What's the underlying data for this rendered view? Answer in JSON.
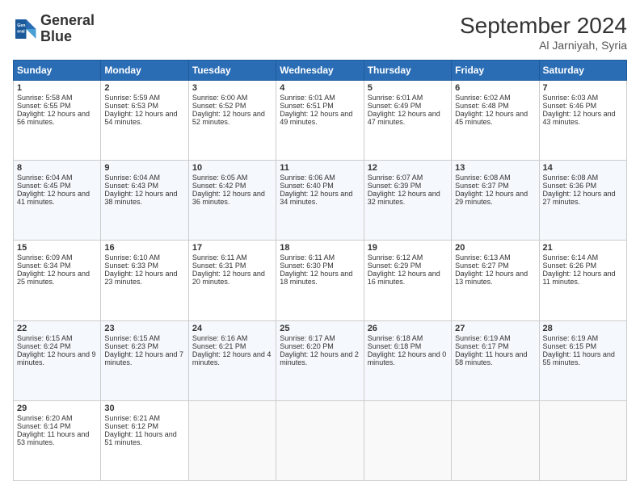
{
  "logo": {
    "line1": "General",
    "line2": "Blue"
  },
  "title": "September 2024",
  "subtitle": "Al Jarniyah, Syria",
  "headers": [
    "Sunday",
    "Monday",
    "Tuesday",
    "Wednesday",
    "Thursday",
    "Friday",
    "Saturday"
  ],
  "weeks": [
    [
      {
        "day": "1",
        "content": "Sunrise: 5:58 AM\nSunset: 6:55 PM\nDaylight: 12 hours and 56 minutes."
      },
      {
        "day": "2",
        "content": "Sunrise: 5:59 AM\nSunset: 6:53 PM\nDaylight: 12 hours and 54 minutes."
      },
      {
        "day": "3",
        "content": "Sunrise: 6:00 AM\nSunset: 6:52 PM\nDaylight: 12 hours and 52 minutes."
      },
      {
        "day": "4",
        "content": "Sunrise: 6:01 AM\nSunset: 6:51 PM\nDaylight: 12 hours and 49 minutes."
      },
      {
        "day": "5",
        "content": "Sunrise: 6:01 AM\nSunset: 6:49 PM\nDaylight: 12 hours and 47 minutes."
      },
      {
        "day": "6",
        "content": "Sunrise: 6:02 AM\nSunset: 6:48 PM\nDaylight: 12 hours and 45 minutes."
      },
      {
        "day": "7",
        "content": "Sunrise: 6:03 AM\nSunset: 6:46 PM\nDaylight: 12 hours and 43 minutes."
      }
    ],
    [
      {
        "day": "8",
        "content": "Sunrise: 6:04 AM\nSunset: 6:45 PM\nDaylight: 12 hours and 41 minutes."
      },
      {
        "day": "9",
        "content": "Sunrise: 6:04 AM\nSunset: 6:43 PM\nDaylight: 12 hours and 38 minutes."
      },
      {
        "day": "10",
        "content": "Sunrise: 6:05 AM\nSunset: 6:42 PM\nDaylight: 12 hours and 36 minutes."
      },
      {
        "day": "11",
        "content": "Sunrise: 6:06 AM\nSunset: 6:40 PM\nDaylight: 12 hours and 34 minutes."
      },
      {
        "day": "12",
        "content": "Sunrise: 6:07 AM\nSunset: 6:39 PM\nDaylight: 12 hours and 32 minutes."
      },
      {
        "day": "13",
        "content": "Sunrise: 6:08 AM\nSunset: 6:37 PM\nDaylight: 12 hours and 29 minutes."
      },
      {
        "day": "14",
        "content": "Sunrise: 6:08 AM\nSunset: 6:36 PM\nDaylight: 12 hours and 27 minutes."
      }
    ],
    [
      {
        "day": "15",
        "content": "Sunrise: 6:09 AM\nSunset: 6:34 PM\nDaylight: 12 hours and 25 minutes."
      },
      {
        "day": "16",
        "content": "Sunrise: 6:10 AM\nSunset: 6:33 PM\nDaylight: 12 hours and 23 minutes."
      },
      {
        "day": "17",
        "content": "Sunrise: 6:11 AM\nSunset: 6:31 PM\nDaylight: 12 hours and 20 minutes."
      },
      {
        "day": "18",
        "content": "Sunrise: 6:11 AM\nSunset: 6:30 PM\nDaylight: 12 hours and 18 minutes."
      },
      {
        "day": "19",
        "content": "Sunrise: 6:12 AM\nSunset: 6:29 PM\nDaylight: 12 hours and 16 minutes."
      },
      {
        "day": "20",
        "content": "Sunrise: 6:13 AM\nSunset: 6:27 PM\nDaylight: 12 hours and 13 minutes."
      },
      {
        "day": "21",
        "content": "Sunrise: 6:14 AM\nSunset: 6:26 PM\nDaylight: 12 hours and 11 minutes."
      }
    ],
    [
      {
        "day": "22",
        "content": "Sunrise: 6:15 AM\nSunset: 6:24 PM\nDaylight: 12 hours and 9 minutes."
      },
      {
        "day": "23",
        "content": "Sunrise: 6:15 AM\nSunset: 6:23 PM\nDaylight: 12 hours and 7 minutes."
      },
      {
        "day": "24",
        "content": "Sunrise: 6:16 AM\nSunset: 6:21 PM\nDaylight: 12 hours and 4 minutes."
      },
      {
        "day": "25",
        "content": "Sunrise: 6:17 AM\nSunset: 6:20 PM\nDaylight: 12 hours and 2 minutes."
      },
      {
        "day": "26",
        "content": "Sunrise: 6:18 AM\nSunset: 6:18 PM\nDaylight: 12 hours and 0 minutes."
      },
      {
        "day": "27",
        "content": "Sunrise: 6:19 AM\nSunset: 6:17 PM\nDaylight: 11 hours and 58 minutes."
      },
      {
        "day": "28",
        "content": "Sunrise: 6:19 AM\nSunset: 6:15 PM\nDaylight: 11 hours and 55 minutes."
      }
    ],
    [
      {
        "day": "29",
        "content": "Sunrise: 6:20 AM\nSunset: 6:14 PM\nDaylight: 11 hours and 53 minutes."
      },
      {
        "day": "30",
        "content": "Sunrise: 6:21 AM\nSunset: 6:12 PM\nDaylight: 11 hours and 51 minutes."
      },
      {
        "day": "",
        "content": ""
      },
      {
        "day": "",
        "content": ""
      },
      {
        "day": "",
        "content": ""
      },
      {
        "day": "",
        "content": ""
      },
      {
        "day": "",
        "content": ""
      }
    ]
  ]
}
